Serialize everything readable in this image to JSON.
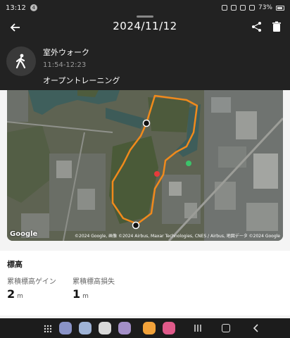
{
  "status_bar": {
    "time": "13:12",
    "notification_count": "4",
    "battery": "73%"
  },
  "header": {
    "title": "2024/11/12"
  },
  "activity": {
    "name": "室外ウォーク",
    "time_range": "11:54-12:23",
    "type": "オープントレーニング",
    "icon": "walking-person-icon"
  },
  "map": {
    "provider_logo": "Google",
    "attribution": "©2024 Google, 画像 ©2024 Airbus, Maxar Technologies, CNES / Airbus, 地図データ ©2024 Google",
    "route_color": "#f08a1c"
  },
  "elevation": {
    "title": "標高",
    "gain_label": "累積標高ゲイン",
    "gain_value": "2",
    "gain_unit": "m",
    "loss_label": "累積標高損失",
    "loss_value": "1",
    "loss_unit": "m"
  },
  "nav_bar": {
    "apps": [
      "phone-app",
      "messages-app",
      "chrome-app",
      "mail-app",
      "notes-app",
      "camera-app"
    ]
  }
}
